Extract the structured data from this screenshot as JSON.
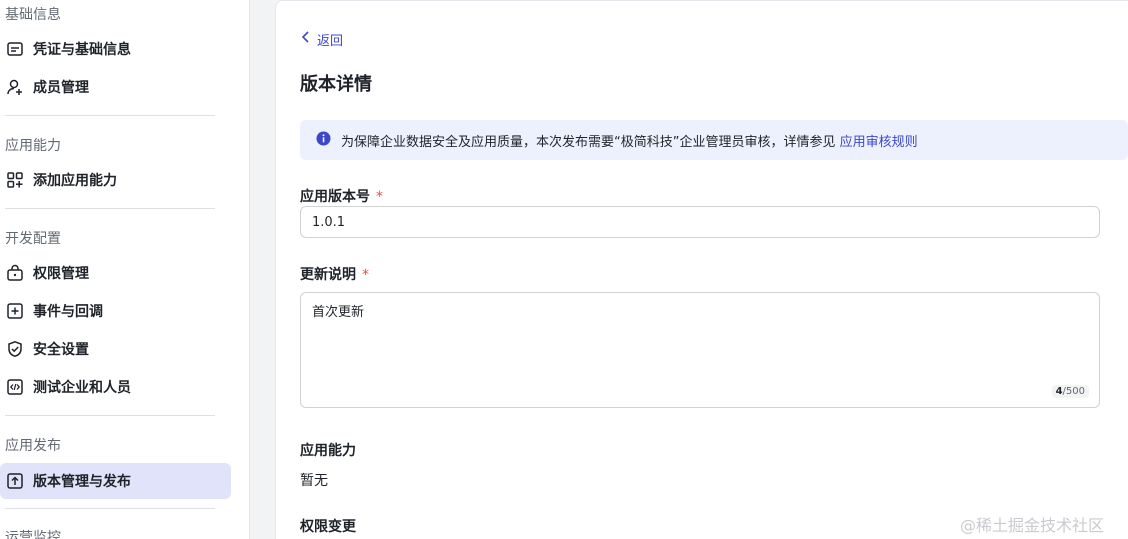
{
  "sidebar": {
    "groups": [
      {
        "title": "基础信息"
      },
      {
        "title": "应用能力"
      },
      {
        "title": "开发配置"
      },
      {
        "title": "应用发布"
      },
      {
        "title": "运营监控"
      }
    ],
    "items": [
      {
        "label": "凭证与基础信息",
        "icon": "credential-icon"
      },
      {
        "label": "成员管理",
        "icon": "user-add-icon"
      },
      {
        "label": "添加应用能力",
        "icon": "grid-add-icon"
      },
      {
        "label": "权限管理",
        "icon": "lock-box-icon"
      },
      {
        "label": "事件与回调",
        "icon": "plus-square-icon"
      },
      {
        "label": "安全设置",
        "icon": "shield-check-icon"
      },
      {
        "label": "测试企业和人员",
        "icon": "code-icon"
      },
      {
        "label": "版本管理与发布",
        "icon": "upload-square-icon",
        "active": true
      }
    ]
  },
  "main": {
    "back_label": "返回",
    "title": "版本详情",
    "notice": {
      "text": "为保障企业数据安全及应用质量，本次发布需要“极简科技”企业管理员审核，详情参见",
      "link": "应用审核规则"
    },
    "version": {
      "label": "应用版本号",
      "required_mark": "*",
      "value": "1.0.1"
    },
    "update_note": {
      "label": "更新说明",
      "required_mark": "*",
      "value": "首次更新",
      "count": "4",
      "max": "/500"
    },
    "capability": {
      "label": "应用能力",
      "value": "暂无"
    },
    "permission_change": {
      "label": "权限变更"
    }
  },
  "watermark": "@稀土掘金技术社区",
  "colors": {
    "accent": "#3c48c8",
    "active_bg": "#e1e3fb",
    "notice_bg": "#edf0fd",
    "required": "#f54a45"
  }
}
